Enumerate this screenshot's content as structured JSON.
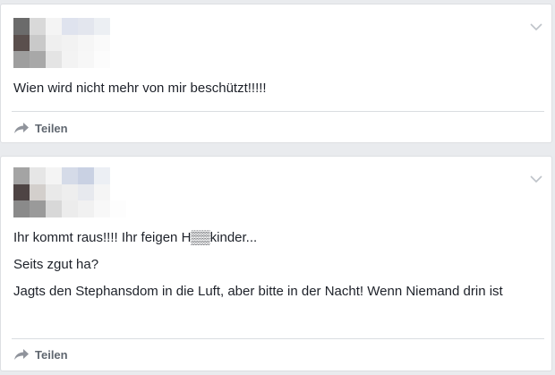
{
  "posts": [
    {
      "lines": [
        "Wien wird nicht mehr von mir beschützt!!!!!"
      ],
      "share_label": "Teilen"
    },
    {
      "lines": [
        "Ihr kommt raus!!!! Ihr feigen H▒▒kinder...",
        "Seits zgut ha?",
        "Jagts den Stephansdom in die Luft, aber bitte in der Nacht! Wenn Niemand drin ist"
      ],
      "share_label": "Teilen"
    }
  ],
  "icons": {
    "menu": "chevron-down-icon",
    "share": "share-arrow-icon",
    "avatar": "pixelated-avatar"
  },
  "colors": {
    "background": "#e9ebee",
    "card": "#ffffff",
    "text": "#1d2129",
    "muted": "#606770",
    "divider": "#dadde1"
  }
}
